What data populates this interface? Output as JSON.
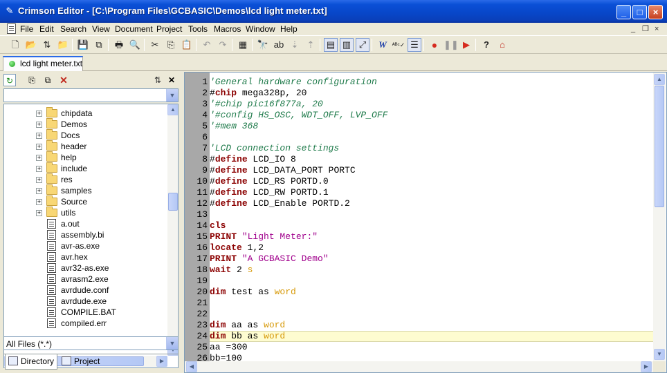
{
  "window": {
    "title": "Crimson Editor - [C:\\Program Files\\GCBASIC\\Demos\\lcd light meter.txt]",
    "controls": [
      "_",
      "□",
      "×"
    ]
  },
  "menu": {
    "items": [
      "File",
      "Edit",
      "Search",
      "View",
      "Document",
      "Project",
      "Tools",
      "Macros",
      "Window",
      "Help"
    ],
    "mdi_controls": [
      "_",
      "❐",
      "×"
    ]
  },
  "toolbar": {
    "icons": [
      "new-file",
      "open-folder",
      "open-remote",
      "open-project",
      "save",
      "save-all",
      "print",
      "print-preview",
      "cut",
      "copy",
      "paste",
      "undo",
      "redo",
      "insert-column",
      "find",
      "find-replace",
      "find-next",
      "find-previous",
      "column-mode",
      "word-wrap",
      "view-whitespace",
      "word-spelling",
      "spell-check",
      "line-numbers",
      "record-macro",
      "pause-macro",
      "play-macro",
      "help",
      "home"
    ],
    "play_color": "#d62b1f",
    "record_color": "#d62b1f"
  },
  "tabs": {
    "active_file": "lcd light meter.txt"
  },
  "sidebar": {
    "tree": [
      {
        "type": "folder",
        "label": "chipdata"
      },
      {
        "type": "folder",
        "label": "Demos"
      },
      {
        "type": "folder",
        "label": "Docs"
      },
      {
        "type": "folder",
        "label": "header"
      },
      {
        "type": "folder",
        "label": "help"
      },
      {
        "type": "folder",
        "label": "include"
      },
      {
        "type": "folder",
        "label": "res"
      },
      {
        "type": "folder",
        "label": "samples"
      },
      {
        "type": "folder",
        "label": "Source"
      },
      {
        "type": "folder",
        "label": "utils"
      },
      {
        "type": "file",
        "label": "a.out"
      },
      {
        "type": "file",
        "label": "assembly.bi"
      },
      {
        "type": "file",
        "label": "avr-as.exe"
      },
      {
        "type": "file",
        "label": "avr.hex"
      },
      {
        "type": "file",
        "label": "avr32-as.exe"
      },
      {
        "type": "file",
        "label": "avrasm2.exe"
      },
      {
        "type": "file",
        "label": "avrdude.conf"
      },
      {
        "type": "file",
        "label": "avrdude.exe"
      },
      {
        "type": "file",
        "label": "COMPILE.BAT"
      },
      {
        "type": "file",
        "label": "compiled.err"
      }
    ],
    "filter": "All Files (*.*)",
    "tabs": [
      "Directory",
      "Project"
    ]
  },
  "editor": {
    "current_line": 24,
    "lines": [
      {
        "n": "1",
        "tokens": [
          {
            "t": "'General hardware configuration",
            "c": "comment"
          }
        ]
      },
      {
        "n": "2",
        "tokens": [
          {
            "t": "#",
            "c": "text"
          },
          {
            "t": "chip",
            "c": "keyword"
          },
          {
            "t": " mega328p, 20",
            "c": "text"
          }
        ]
      },
      {
        "n": "3",
        "tokens": [
          {
            "t": "'#chip pic16f877a, 20",
            "c": "comment"
          }
        ]
      },
      {
        "n": "4",
        "tokens": [
          {
            "t": "'#config HS_OSC, WDT_OFF, LVP_OFF",
            "c": "comment"
          }
        ]
      },
      {
        "n": "5",
        "tokens": [
          {
            "t": "'#mem 368",
            "c": "comment"
          }
        ]
      },
      {
        "n": "6",
        "tokens": []
      },
      {
        "n": "7",
        "tokens": [
          {
            "t": "'LCD connection settings",
            "c": "comment"
          }
        ]
      },
      {
        "n": "8",
        "tokens": [
          {
            "t": "#",
            "c": "text"
          },
          {
            "t": "define",
            "c": "keyword"
          },
          {
            "t": " LCD_IO 8",
            "c": "text"
          }
        ]
      },
      {
        "n": "9",
        "tokens": [
          {
            "t": "#",
            "c": "text"
          },
          {
            "t": "define",
            "c": "keyword"
          },
          {
            "t": " LCD_DATA_PORT PORTC",
            "c": "text"
          }
        ]
      },
      {
        "n": "10",
        "tokens": [
          {
            "t": "#",
            "c": "text"
          },
          {
            "t": "define",
            "c": "keyword"
          },
          {
            "t": " LCD_RS PORTD.0",
            "c": "text"
          }
        ]
      },
      {
        "n": "11",
        "tokens": [
          {
            "t": "#",
            "c": "text"
          },
          {
            "t": "define",
            "c": "keyword"
          },
          {
            "t": " LCD_RW PORTD.1",
            "c": "text"
          }
        ]
      },
      {
        "n": "12",
        "tokens": [
          {
            "t": "#",
            "c": "text"
          },
          {
            "t": "define",
            "c": "keyword"
          },
          {
            "t": " LCD_Enable PORTD.2",
            "c": "text"
          }
        ]
      },
      {
        "n": "13",
        "tokens": []
      },
      {
        "n": "14",
        "tokens": [
          {
            "t": "cls",
            "c": "keyword"
          }
        ]
      },
      {
        "n": "15",
        "tokens": [
          {
            "t": "PRINT",
            "c": "keyword"
          },
          {
            "t": " ",
            "c": "text"
          },
          {
            "t": "\"Light Meter:\"",
            "c": "string"
          }
        ]
      },
      {
        "n": "16",
        "tokens": [
          {
            "t": "locate",
            "c": "keyword"
          },
          {
            "t": " 1,2",
            "c": "text"
          }
        ]
      },
      {
        "n": "17",
        "tokens": [
          {
            "t": "PRINT",
            "c": "keyword"
          },
          {
            "t": " ",
            "c": "text"
          },
          {
            "t": "\"A GCBASIC Demo\"",
            "c": "string"
          }
        ]
      },
      {
        "n": "18",
        "tokens": [
          {
            "t": "wait",
            "c": "keyword"
          },
          {
            "t": " 2 ",
            "c": "text"
          },
          {
            "t": "s",
            "c": "type"
          }
        ]
      },
      {
        "n": "19",
        "tokens": []
      },
      {
        "n": "20",
        "tokens": [
          {
            "t": "dim",
            "c": "keyword"
          },
          {
            "t": " test as ",
            "c": "text"
          },
          {
            "t": "word",
            "c": "type"
          }
        ]
      },
      {
        "n": "21",
        "tokens": []
      },
      {
        "n": "22",
        "tokens": []
      },
      {
        "n": "23",
        "tokens": [
          {
            "t": "dim",
            "c": "keyword"
          },
          {
            "t": " aa as ",
            "c": "text"
          },
          {
            "t": "word",
            "c": "type"
          }
        ]
      },
      {
        "n": "24",
        "tokens": [
          {
            "t": "dim",
            "c": "keyword"
          },
          {
            "t": " bb as ",
            "c": "text"
          },
          {
            "t": "word",
            "c": "type"
          }
        ]
      },
      {
        "n": "25",
        "tokens": [
          {
            "t": "aa =300",
            "c": "text"
          }
        ]
      },
      {
        "n": "26",
        "tokens": [
          {
            "t": "bb=100",
            "c": "text"
          }
        ]
      }
    ]
  }
}
